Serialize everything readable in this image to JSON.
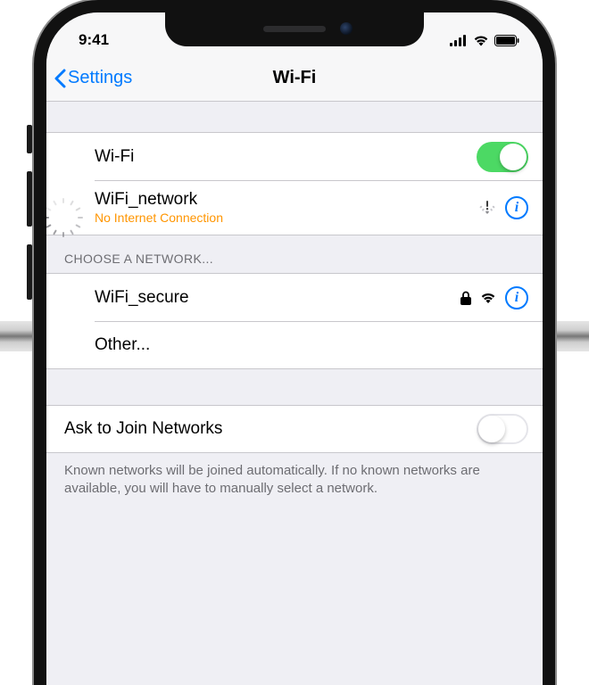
{
  "statusbar": {
    "time": "9:41"
  },
  "navbar": {
    "back_label": "Settings",
    "title": "Wi-Fi"
  },
  "wifi_row": {
    "label": "Wi-Fi",
    "enabled": true
  },
  "current_network": {
    "name": "WiFi_network",
    "status": "No Internet Connection"
  },
  "choose_header": "CHOOSE A NETWORK...",
  "networks": [
    {
      "name": "WiFi_secure",
      "secure": true
    }
  ],
  "other_label": "Other...",
  "ask_join": {
    "label": "Ask to Join Networks",
    "enabled": false,
    "footer": "Known networks will be joined automatically. If no known networks are available, you will have to manually select a network."
  }
}
